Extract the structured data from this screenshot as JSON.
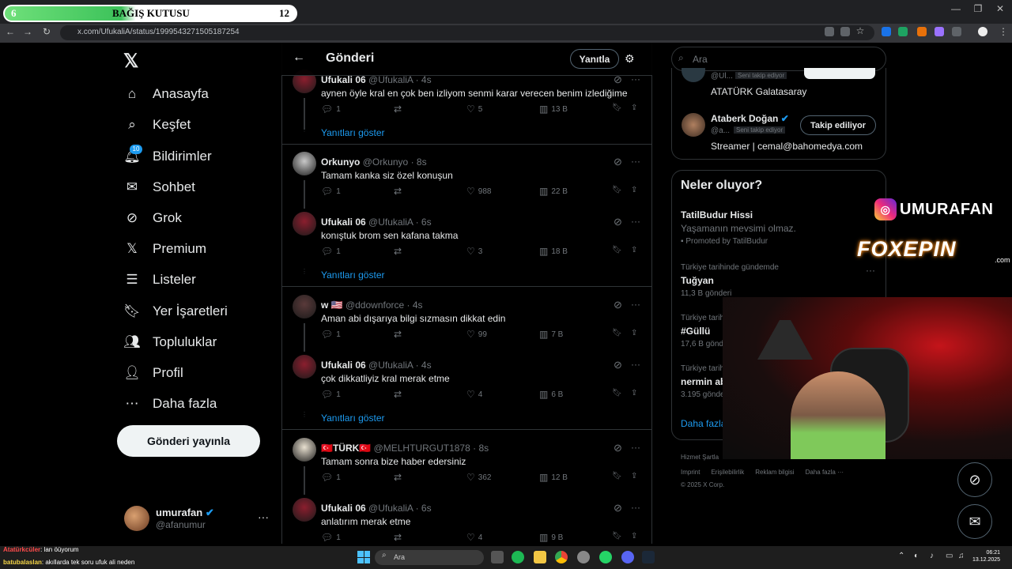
{
  "overlay": {
    "donation": {
      "left": "6",
      "title": "BAĞIŞ KUTUSU",
      "right": "12"
    },
    "instagram_handle": "UMURAFAN",
    "sponsor": "FOXEPIN",
    "sponsor_domain": ".com",
    "chat": [
      {
        "user": "Atatürkcüler",
        "text": ": lan öüyorum"
      },
      {
        "user": "batubalaslan",
        "text": ": akıllarda tek soru ufuk ali neden"
      }
    ]
  },
  "browser": {
    "url": "x.com/UfukaliA/status/1999543271505187254"
  },
  "sidebar": {
    "items": [
      {
        "label": "Anasayfa",
        "icon": "home-icon"
      },
      {
        "label": "Keşfet",
        "icon": "search-icon"
      },
      {
        "label": "Bildirimler",
        "icon": "bell-icon",
        "badge": "10"
      },
      {
        "label": "Sohbet",
        "icon": "mail-icon"
      },
      {
        "label": "Grok",
        "icon": "grok-icon"
      },
      {
        "label": "Premium",
        "icon": "x-icon"
      },
      {
        "label": "Listeler",
        "icon": "list-icon"
      },
      {
        "label": "Yer İşaretleri",
        "icon": "bookmark-icon"
      },
      {
        "label": "Topluluklar",
        "icon": "community-icon"
      },
      {
        "label": "Profil",
        "icon": "person-icon"
      },
      {
        "label": "Daha fazla",
        "icon": "more-circle-icon"
      }
    ],
    "post_button": "Gönderi yayınla",
    "account": {
      "name": "umurafan",
      "handle": "@afanumur"
    }
  },
  "main": {
    "title": "Gönderi",
    "reply_button": "Yanıtla",
    "show_replies": "Yanıtları göster",
    "tweets": [
      {
        "name": "Ufukali 06",
        "handle": "@UfukaliA",
        "time": "4s",
        "text": "aynen öyle kral en çok ben izliyom senmi karar verecen benim izlediğime",
        "replies": "1",
        "retweets": "",
        "likes": "5",
        "views": "13 B"
      },
      {
        "name": "Orkunyo",
        "handle": "@Orkunyo",
        "time": "8s",
        "text": "Tamam kanka siz özel konuşun",
        "replies": "1",
        "retweets": "",
        "likes": "988",
        "views": "22 B"
      },
      {
        "name": "Ufukali 06",
        "handle": "@UfukaliA",
        "time": "6s",
        "text": "konıştuk brom sen kafana takma",
        "replies": "1",
        "retweets": "",
        "likes": "3",
        "views": "18 B"
      },
      {
        "name": "w 🇺🇸",
        "handle": "@ddownforce",
        "time": "4s",
        "text": "Aman abi dışarıya bilgi sızmasın dikkat edin",
        "replies": "1",
        "retweets": "",
        "likes": "99",
        "views": "7 B"
      },
      {
        "name": "Ufukali 06",
        "handle": "@UfukaliA",
        "time": "4s",
        "text": "çok dikkatliyiz kral merak etme",
        "replies": "1",
        "retweets": "",
        "likes": "4",
        "views": "6 B"
      },
      {
        "name": "🇹🇷TÜRK🇹🇷",
        "handle": "@MELHTURGUT1878",
        "time": "8s",
        "text": "Tamam sonra bize haber edersiniz",
        "replies": "1",
        "retweets": "",
        "likes": "362",
        "views": "12 B"
      },
      {
        "name": "Ufukali 06",
        "handle": "@UfukaliA",
        "time": "6s",
        "text": "anlatırım merak etme",
        "replies": "1",
        "retweets": "",
        "likes": "4",
        "views": "9 B"
      }
    ]
  },
  "right": {
    "search_placeholder": "Ara",
    "who": [
      {
        "name": "",
        "handle": "@Ul...",
        "follows_you": "Seni takip ediyor",
        "bio": "ATATÜRK Galatasaray"
      },
      {
        "name": "Ataberk Doğan",
        "handle": "@a...",
        "follows_you": "Seni takip ediyor",
        "bio": "Streamer | cemal@bahomedya.com",
        "button": "Takip ediliyor"
      }
    ],
    "trends_title": "Neler oluyor?",
    "promoted": {
      "title": "TatilBudur Hissi",
      "desc": "Yaşamanın mevsimi olmaz.",
      "by": "Promoted by TatilBudur"
    },
    "trends": [
      {
        "context": "Türkiye tarihinde gündemde",
        "name": "Tuğyan",
        "count": "11,3 B gönderi"
      },
      {
        "context": "Türkiye tarih",
        "name": "#Güllü",
        "count": "17,6 B gönde"
      },
      {
        "context": "Türkiye tarih",
        "name": "nermin ab",
        "count": "3.195 gönde"
      }
    ],
    "more_link": "Daha fazla",
    "footer_line1": "Hizmet Şartla",
    "footer_links": [
      "Imprint",
      "Erişilebilirlik",
      "Reklam bilgisi",
      "Daha fazla ···"
    ],
    "copyright": "© 2025 X Corp."
  },
  "taskbar": {
    "search": "Ara",
    "time": "06:21",
    "date": "13.12.2025"
  }
}
